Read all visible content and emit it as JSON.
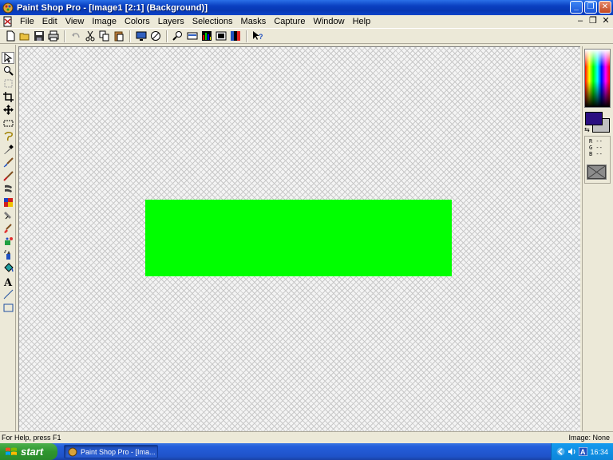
{
  "window": {
    "title": "Paint Shop Pro - [Image1 [2:1] (Background)]",
    "minimize_glyph": "_",
    "maximize_glyph": "❐",
    "close_glyph": "✕"
  },
  "menubar": {
    "items": [
      "File",
      "Edit",
      "View",
      "Image",
      "Colors",
      "Layers",
      "Selections",
      "Masks",
      "Capture",
      "Window",
      "Help"
    ],
    "mdi_minimize": "–",
    "mdi_restore": "❐",
    "mdi_close": "✕"
  },
  "toolbar": {
    "icons": [
      "new-icon",
      "open-icon",
      "save-icon",
      "print-icon",
      "undo-icon",
      "cut-icon",
      "copy-icon",
      "paste-icon",
      "full-screen-preview-icon",
      "browse-icon",
      "zoom-icon",
      "toggle-toolbar-icon",
      "histogram-icon",
      "overview-icon",
      "color-palette-icon",
      "context-help-icon"
    ]
  },
  "tools": {
    "icons": [
      "arrow-icon",
      "zoom-icon",
      "deformation-icon",
      "crop-icon",
      "mover-icon",
      "selection-icon",
      "freehand-selection-icon",
      "dropper-icon",
      "paint-brush-icon",
      "clone-brush-icon",
      "color-replacer-icon",
      "retouch-icon",
      "scratch-remover-icon",
      "eraser-icon",
      "picture-tube-icon",
      "airbrush-icon",
      "flood-fill-icon",
      "text-icon",
      "line-icon",
      "shape-icon"
    ]
  },
  "canvas": {
    "shape_color": "#00ff00",
    "background": "transparent-checker"
  },
  "color_palette": {
    "foreground_color": "#2a0e80",
    "background_color": "#c0c0c0",
    "swap_glyph": "⇆",
    "r_label": "R --",
    "g_label": "G --",
    "b_label": "B --"
  },
  "statusbar": {
    "help_text": "For Help, press F1",
    "image_info": "Image: None"
  },
  "taskbar": {
    "start_label": "start",
    "task_button_label": "Paint Shop Pro - [Ima...",
    "clock": "16:34"
  }
}
